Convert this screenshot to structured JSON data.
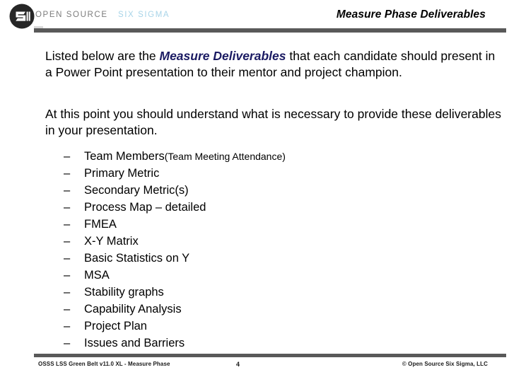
{
  "header": {
    "logo_icon": "oss-circle-logo-icon",
    "wordmark_primary": "OPEN SOURCE",
    "wordmark_secondary": "SIX SIGMA",
    "title": "Measure Phase Deliverables",
    "colors": {
      "wordmark_primary": "#7c7c7c",
      "wordmark_secondary": "#a8d4e8",
      "rule": "#595959"
    }
  },
  "body": {
    "paragraph_1": {
      "before": "Listed below are the ",
      "emphasis": "Measure Deliverables",
      "after": " that each candidate should present in a Power Point presentation to their mentor and project champion.",
      "emphasis_color": "#1b1b63"
    },
    "paragraph_2": "At this point you should understand what is necessary to provide these deliverables in your presentation."
  },
  "deliverables": {
    "dash": "–",
    "items": [
      {
        "text": "Team Members ",
        "sub": "(Team Meeting Attendance)"
      },
      {
        "text": "Primary Metric",
        "sub": ""
      },
      {
        "text": "Secondary Metric(s)",
        "sub": ""
      },
      {
        "text": "Process Map – detailed",
        "sub": ""
      },
      {
        "text": "FMEA",
        "sub": ""
      },
      {
        "text": "X-Y Matrix",
        "sub": ""
      },
      {
        "text": "Basic Statistics on Y",
        "sub": ""
      },
      {
        "text": "MSA",
        "sub": ""
      },
      {
        "text": "Stability graphs",
        "sub": ""
      },
      {
        "text": "Capability Analysis",
        "sub": ""
      },
      {
        "text": "Project Plan",
        "sub": ""
      },
      {
        "text": "Issues and Barriers",
        "sub": ""
      }
    ]
  },
  "footer": {
    "left": "OSSS LSS Green Belt v11.0 XL - Measure Phase",
    "page_number": "4",
    "right": "© Open Source Six Sigma, LLC"
  }
}
